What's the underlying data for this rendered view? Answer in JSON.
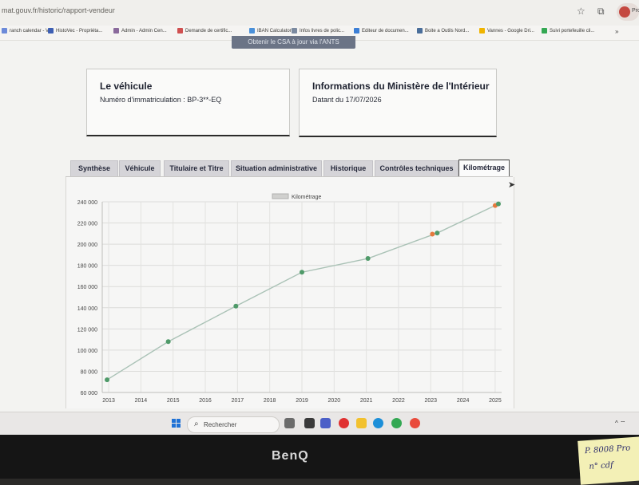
{
  "browser": {
    "url": "mat.gouv.fr/historic/rapport-vendeur",
    "bookmarks": [
      {
        "label": "ranch calendar - V...",
        "color": "#6c8ad9"
      },
      {
        "label": "HistoVec - Propriéta...",
        "color": "#3d5fb3"
      },
      {
        "label": "Admin - Admin Cen...",
        "color": "#8a6a9c"
      },
      {
        "label": "Demande de certific...",
        "color": "#d05050"
      },
      {
        "label": "IBAN Calculator",
        "color": "#4a90d9"
      },
      {
        "label": "Infos livres de polic...",
        "color": "#7b8aa0"
      },
      {
        "label": "Editeur de documen...",
        "color": "#3c7fd6"
      },
      {
        "label": "Boite a Outils Nord...",
        "color": "#4a6e9a"
      },
      {
        "label": "Vannes - Google Dri...",
        "color": "#f0b400"
      },
      {
        "label": "Suivi portefeuille cli...",
        "color": "#34a853"
      }
    ]
  },
  "page": {
    "csa_button": "Obtenir le CSA à jour via l'ANTS",
    "vehicle_card": {
      "title": "Le véhicule",
      "plate": "Numéro d'immatriculation : BP-3**-EQ"
    },
    "ministry_card": {
      "title": "Informations du Ministère de l'Intérieur",
      "date": "Datant du 17/07/2026"
    },
    "tabs": [
      {
        "label": "Synthèse"
      },
      {
        "label": "Véhicule"
      },
      {
        "label": "Titulaire et Titre"
      },
      {
        "label": "Situation administrative"
      },
      {
        "label": "Historique"
      },
      {
        "label": "Contrôles techniques"
      },
      {
        "label": "Kilométrage"
      }
    ],
    "active_tab": 6
  },
  "chart_data": {
    "type": "line",
    "series": [
      {
        "name": "Kilométrage"
      }
    ],
    "x_ticks": [
      2013,
      2014,
      2015,
      2016,
      2017,
      2018,
      2019,
      2020,
      2021,
      2022,
      2023,
      2024,
      2025
    ],
    "y_ticks": [
      "60 000",
      "80 000",
      "100 000",
      "120 000",
      "140 000",
      "160 000",
      "180 000",
      "200 000",
      "220 000",
      "240 000"
    ],
    "ylim": [
      60000,
      240000
    ],
    "xlim": [
      2012.8,
      2025.2
    ],
    "points": [
      {
        "x": 2012.95,
        "y": 72000
      },
      {
        "x": 2014.85,
        "y": 108000
      },
      {
        "x": 2016.95,
        "y": 141500
      },
      {
        "x": 2019.0,
        "y": 173500
      },
      {
        "x": 2021.05,
        "y": 186500
      },
      {
        "x": 2023.2,
        "y": 210500
      },
      {
        "x": 2025.1,
        "y": 238000
      }
    ],
    "highlight_points": [
      {
        "x": 2023.05,
        "y": 209500
      },
      {
        "x": 2025.0,
        "y": 236500
      }
    ],
    "colors": {
      "line": "#aac2b6",
      "point": "#4f9a69",
      "highlight": "#e5793d"
    },
    "grid": true,
    "legend": "top-center"
  },
  "taskbar": {
    "search_placeholder": "Rechercher"
  },
  "monitor": {
    "brand": "BenQ"
  },
  "note": {
    "line1": "P. 8008 Pro",
    "line2": "n° cdf"
  }
}
